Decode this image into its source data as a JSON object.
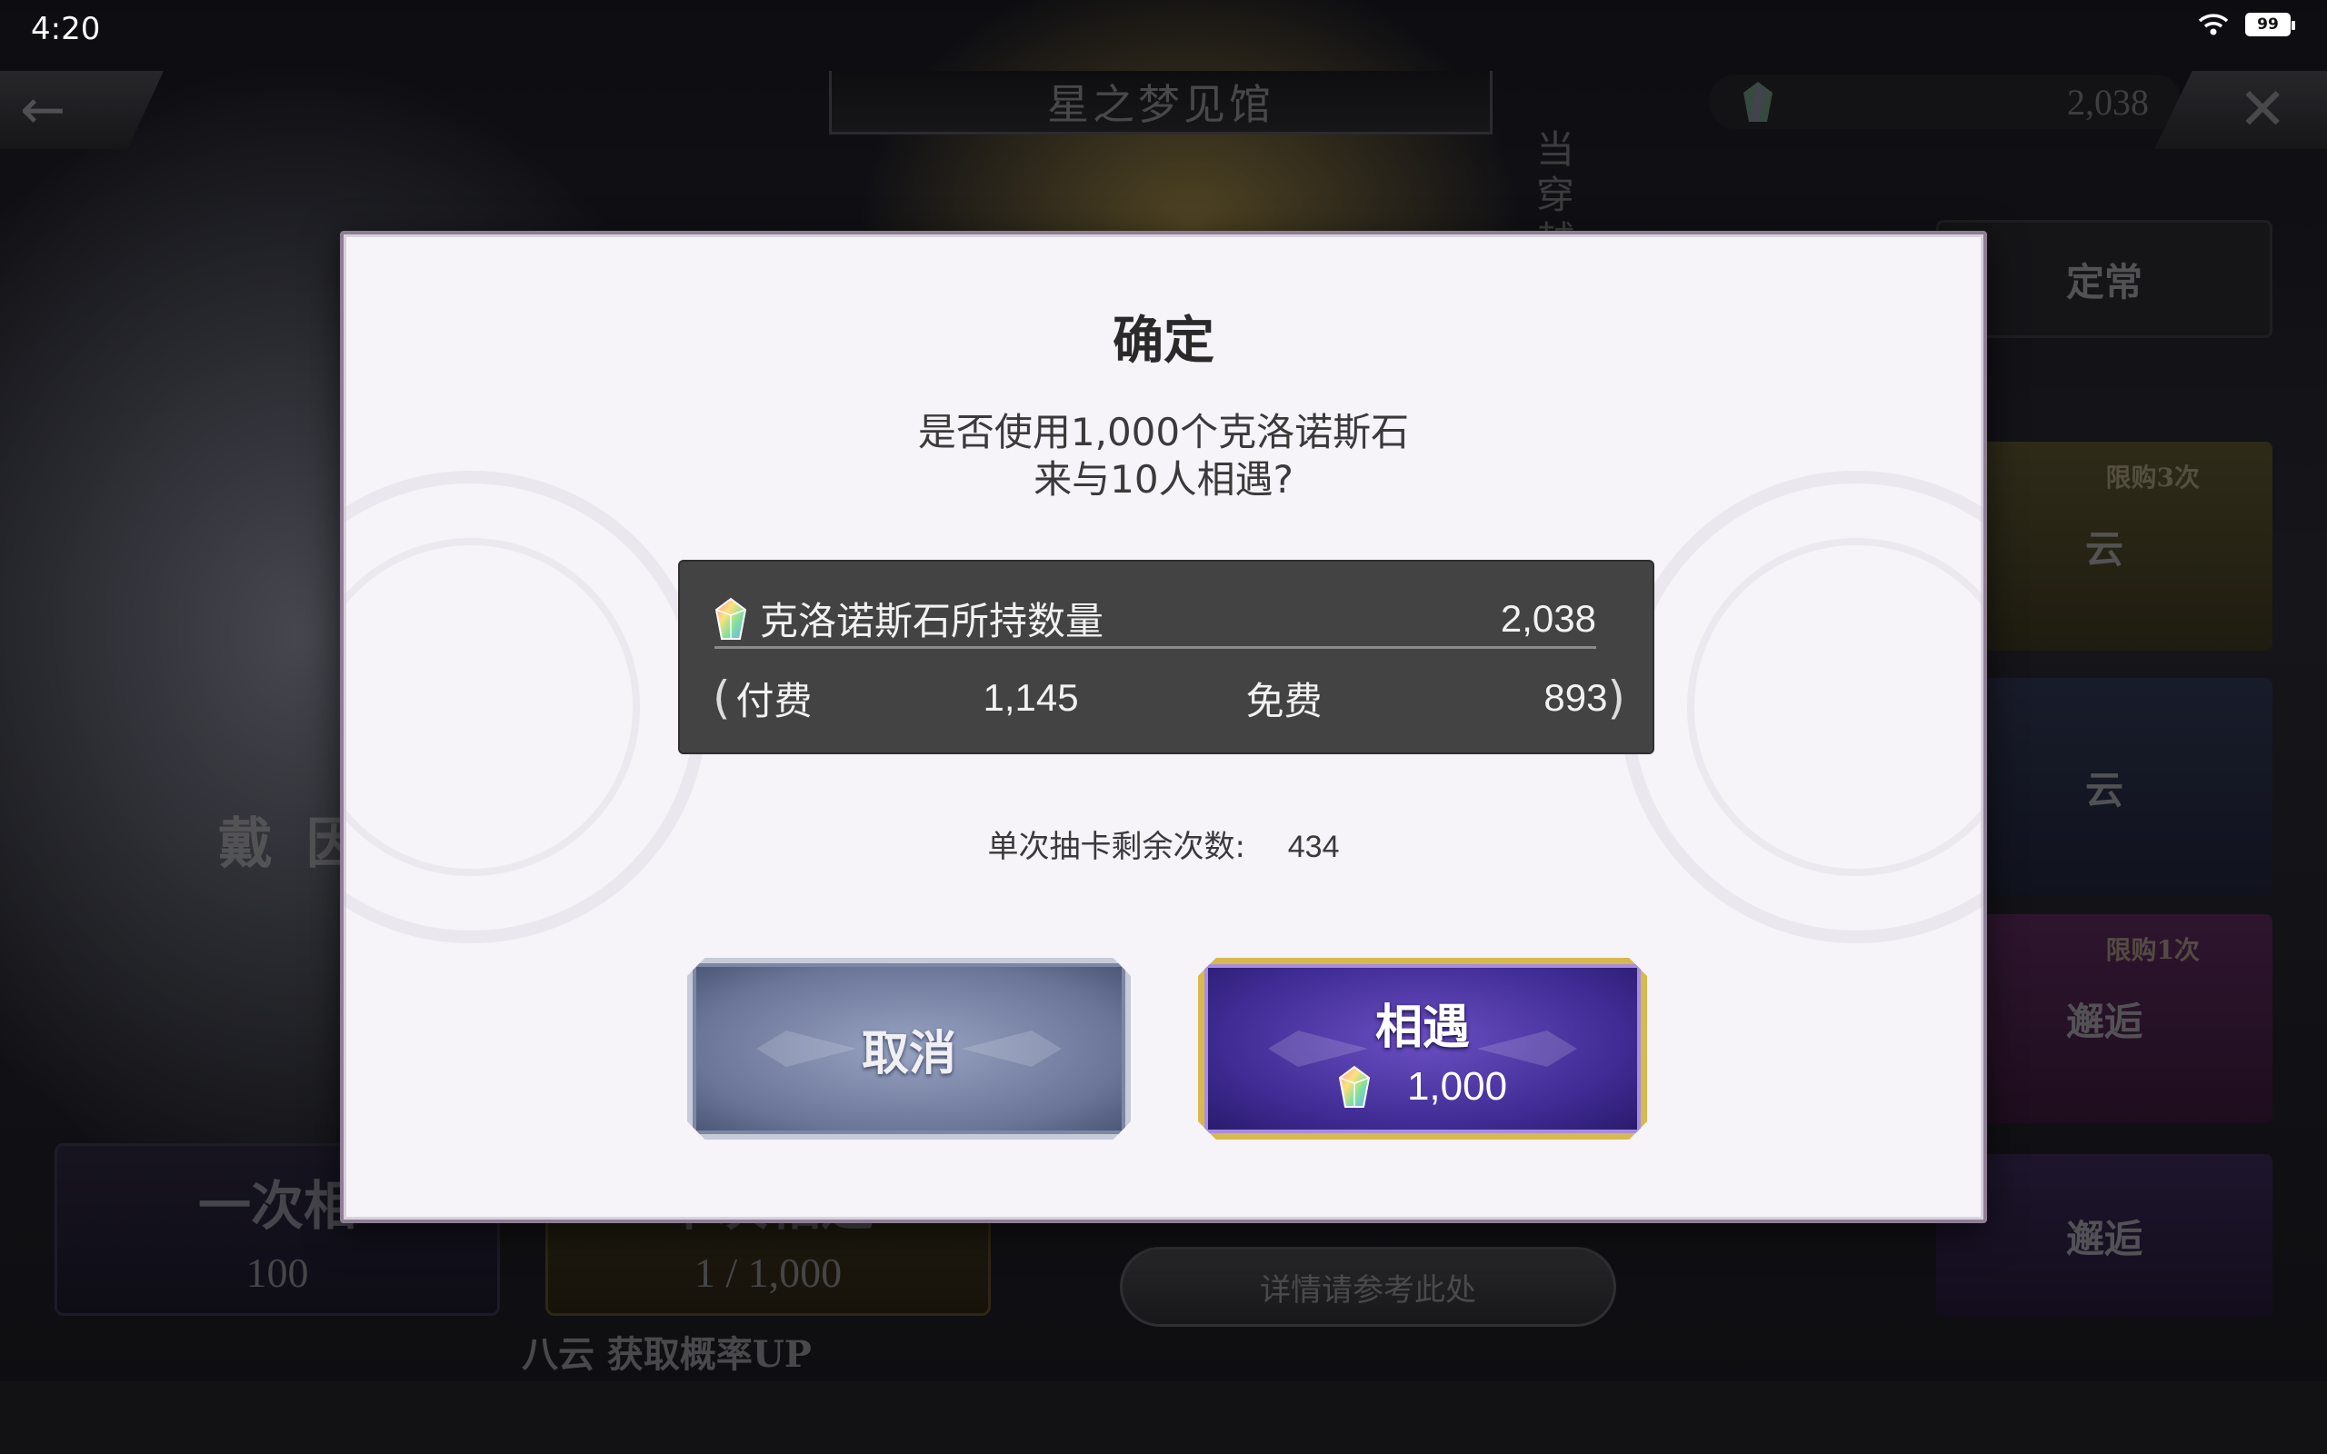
{
  "status_bar": {
    "time": "4:20",
    "battery": "99"
  },
  "header": {
    "venue_title": "星之梦见馆",
    "currency_value": "2,038"
  },
  "background": {
    "side_vertical_text": "当穿越",
    "tab_regular": "定常",
    "limit3_label": "限购3次",
    "limit3_banner": "云",
    "mid_banner": "云",
    "limit1_label": "限购1次",
    "limit1_banner": "邂逅",
    "bottom_banner": "邂逅",
    "left_char_name": "戴 因",
    "one_draw_label": "一次相",
    "one_draw_cost": "100",
    "ten_draw_label": "十次相遇",
    "ten_draw_cost": "1 / 1,000",
    "details_button": "详情请参考此处",
    "rate_up_text": "八云 获取概率UP"
  },
  "dialog": {
    "title": "确定",
    "message_line1": "是否使用1,000个克洛诺斯石",
    "message_line2": "来与10人相遇?",
    "balance_label": "克洛诺斯石所持数量",
    "balance_value": "2,038",
    "paren_open": "(",
    "paren_close": ")",
    "paid_label": "付费",
    "paid_value": "1,145",
    "free_label": "免费",
    "free_value": "893",
    "remaining_label": "单次抽卡剩余次数:",
    "remaining_value": "434",
    "cancel_button": "取消",
    "confirm_button": "相遇",
    "confirm_cost": "1,000"
  },
  "icons": {
    "gem": "chronos-stone-icon",
    "back": "back-arrow-icon",
    "close": "close-icon",
    "wifi": "wifi-icon",
    "battery": "battery-icon"
  },
  "colors": {
    "dialog_bg": "#f6f3f9",
    "balance_box": "#434343",
    "cancel_button": "#6a7598",
    "confirm_button": "#3f2b93",
    "confirm_border": "#d7b94e"
  }
}
